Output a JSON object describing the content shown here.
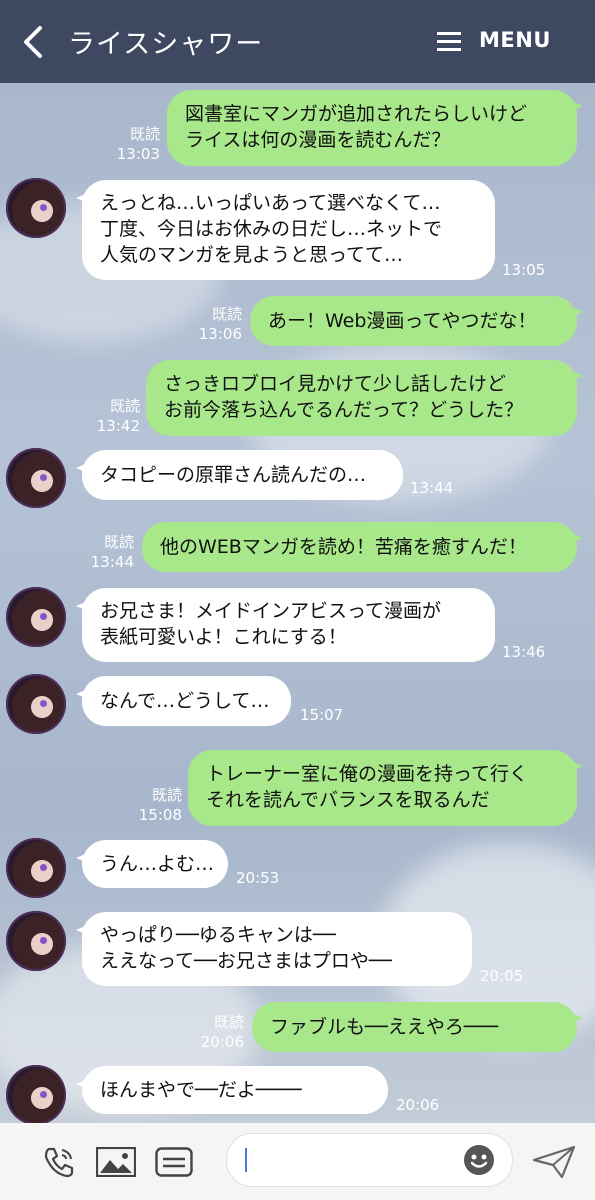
{
  "header": {
    "title": "ライスシャワー",
    "menu_label": "MENU"
  },
  "messages": [
    {
      "side": "right",
      "text": "図書室にマンガが追加されたらしいけど\nライスは何の漫画を読むんだ？",
      "read": "既読",
      "time": "13:03"
    },
    {
      "side": "left",
      "text": "えっとね…いっぱいあって選べなくて…\n丁度、今日はお休みの日だし…ネットで\n人気のマンガを見ようと思ってて…",
      "time": "13:05"
    },
    {
      "side": "right",
      "text": "あー！Web漫画ってやつだな！",
      "read": "既読",
      "time": "13:06"
    },
    {
      "side": "right",
      "text": "さっきロブロイ見かけて少し話したけど\nお前今落ち込んでるんだって？どうした？",
      "read": "既読",
      "time": "13:42"
    },
    {
      "side": "left",
      "text": "タコピーの原罪さん読んだの…",
      "time": "13:44"
    },
    {
      "side": "right",
      "text": "他のWEBマンガを読め！苦痛を癒すんだ！",
      "read": "既読",
      "time": "13:44"
    },
    {
      "side": "left",
      "text": "お兄さま！メイドインアビスって漫画が\n表紙可愛いよ！これにする！",
      "time": "13:46"
    },
    {
      "side": "left",
      "text": "なんで…どうして…",
      "time": "15:07"
    },
    {
      "side": "right",
      "text": "トレーナー室に俺の漫画を持って行く\nそれを読んでバランスを取るんだ",
      "read": "既読",
      "time": "15:08"
    },
    {
      "side": "left",
      "text": "うん…よむ…",
      "time": "20:53"
    },
    {
      "side": "left",
      "text": "やっぱり──ゆるキャンは──\nええなって──お兄さまはプロや──",
      "time": "20:05"
    },
    {
      "side": "right",
      "text": "ファブルも──ええやろ───",
      "read": "既読",
      "time": "20:06"
    },
    {
      "side": "left",
      "text": "ほんまやで──だよ────",
      "time": "20:06"
    }
  ],
  "footer": {
    "input_value": ""
  },
  "icons": {
    "call": "phone-icon",
    "image": "image-icon",
    "sticker": "keyboard-icon",
    "emoji": "emoji-icon",
    "send": "send-icon"
  },
  "colors": {
    "header": "#3e4860",
    "sent_bubble": "#a8e88a",
    "received_bubble": "#ffffff",
    "footer": "#f5f5f5"
  }
}
